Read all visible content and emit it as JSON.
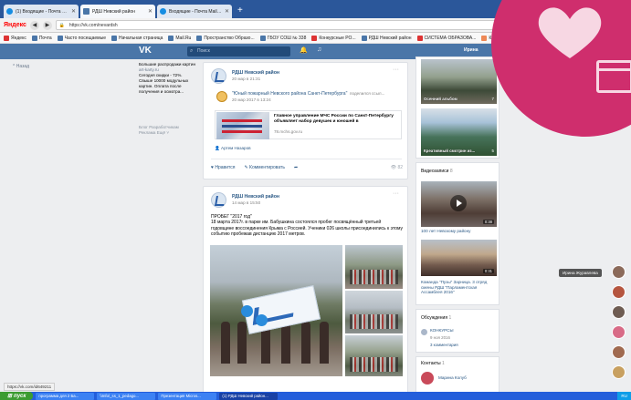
{
  "browser": {
    "tabs": [
      {
        "label": "(1) Входящие - Почта Mail.Ru",
        "icon": "mail-icon",
        "active": false
      },
      {
        "label": "РДШ Невский район",
        "icon": "vk-icon",
        "active": true
      },
      {
        "label": "Входящие - Почта Mail.Ru",
        "icon": "mail-icon",
        "active": false
      }
    ],
    "yandex_label": "Яндекс",
    "url": "https://vk.com/nevardsh",
    "bookmarks": [
      "Яндекс",
      "Почта",
      "Часто посещаемые",
      "Начальная страница",
      "Mail.Ru",
      "Пространство Образо...",
      "ГБОУ СОШ № 338",
      "Конкурсные РО...",
      "РДШ Невский район",
      "СИСТЕМА ОБРАЗОВА...",
      "Комитет по ...",
      "диск – Google Д..."
    ]
  },
  "vk": {
    "search_placeholder": "Поиск",
    "user_name": "Ирина",
    "left_nav_back": "Назад",
    "ad": {
      "title": "Большие распродажи картин",
      "site": "art-karty.ru",
      "text": "Сегодня скидки - 72%. Свыше 10000 модульных картин. Оплата после получения и осмотра..."
    },
    "footer_links": "Блог  Разработчикам  Реклама  Ещё ˅"
  },
  "post1": {
    "author": "РДШ Невский район",
    "date": "20 мар в 21:31",
    "repost_from": "\"Юный пожарный Невского района Санкт-Петербурга\"",
    "repost_action": "поделился ссыл...",
    "repost_date": "20 мар 2017 в 13:24",
    "link_title": "Главное управление МЧС России по Санкт-Петербургу объявляет набор девушек и юношей в",
    "link_site": "78.mchs.gov.ru",
    "signer": "Артем Назаров",
    "like_label": "Нравится",
    "comment_label": "Комментировать",
    "views": "82"
  },
  "post2": {
    "author": "РДШ Невский район",
    "date": "14 мар в 15:50",
    "text_title": "ПРОБЕГ \"2017 год\"",
    "text_body": "18 марта 2017г. в парке им. Бабушкина состоялся пробег посвящённый третьей годовщине воссоединения Крыма с Россией. Ученики 026 школы присоединились к этому событию пробежав дистанцию 2017 метров."
  },
  "right": {
    "album1_caption": "Осенний альбом",
    "album1_count": "7",
    "album2_caption": "Креативный смотрин из...",
    "album2_count": "5",
    "videos_label": "Видеозаписи",
    "videos_count": "8",
    "video1_duration": "0:38",
    "video1_title": "100 лет Невскому району",
    "video2_duration": "0:31",
    "video2_title": "Команда \"Пузы\" Зарница. 3 отряд смены РДШ \"Парламентская Ассамблея 2016\"",
    "discussions_label": "Обсуждения",
    "discussions_count": "1",
    "discussion_title": "КОНКУРСЫ",
    "discussion_date": "9 ноя 2016",
    "discussion_comments": "3 комментария",
    "contacts_label": "Контакты",
    "contacts_count": "1",
    "contact_name": "Марина Колуб"
  },
  "chat": {
    "tooltip": "Ирина Журавлева"
  },
  "status_url": "https://vk.com/id649211",
  "taskbar": {
    "start": "пуск",
    "tasks": [
      "программа для 2 Ба...",
      "\\\\Info\\_ss_1_pedago...",
      "Презентация Micros...",
      "(1) РДШ Невский район..."
    ],
    "tray": "RU"
  }
}
